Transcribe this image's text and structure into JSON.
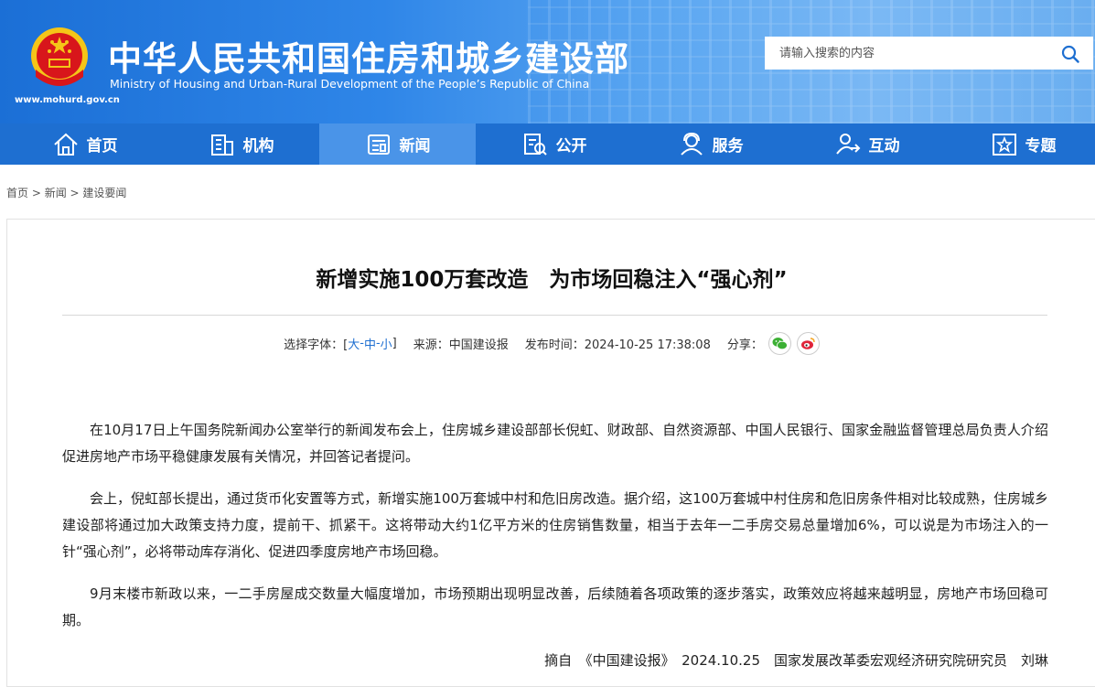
{
  "header": {
    "title_cn": "中华人民共和国住房和城乡建设部",
    "title_en": "Ministry of Housing and Urban-Rural Development of the People’s Republic of China",
    "site_url": "www.mohurd.gov.cn",
    "search_placeholder": "请输入搜索的内容"
  },
  "nav": {
    "items": [
      {
        "label": "首页",
        "icon": "home-icon"
      },
      {
        "label": "机构",
        "icon": "building-icon"
      },
      {
        "label": "新闻",
        "icon": "news-icon"
      },
      {
        "label": "公开",
        "icon": "disclosure-icon"
      },
      {
        "label": "服务",
        "icon": "service-icon"
      },
      {
        "label": "互动",
        "icon": "interaction-icon"
      },
      {
        "label": "专题",
        "icon": "star-icon"
      }
    ],
    "active_index": 2
  },
  "breadcrumb": {
    "home": "首页",
    "sep1": " > ",
    "news": "新闻",
    "sep2": " > ",
    "current": "建设要闻"
  },
  "article": {
    "title": "新增实施100万套改造　为市场回稳注入“强心剂”",
    "meta": {
      "font_label": "选择字体：[ ",
      "size_large": "大",
      "size_mid": "中",
      "size_small": "小",
      "dash": " - ",
      "font_close": " ]",
      "source_label": "来源：中国建设报",
      "time_label": "发布时间：2024-10-25 17:38:08",
      "share_label": "分享："
    },
    "paragraphs": [
      "在10月17日上午国务院新闻办公室举行的新闻发布会上，住房城乡建设部部长倪虹、财政部、自然资源部、中国人民银行、国家金融监督管理总局负责人介绍促进房地产市场平稳健康发展有关情况，并回答记者提问。",
      "会上，倪虹部长提出，通过货币化安置等方式，新增实施100万套城中村和危旧房改造。据介绍，这100万套城中村住房和危旧房条件相对比较成熟，住房城乡建设部将通过加大政策支持力度，提前干、抓紧干。这将带动大约1亿平方米的住房销售数量，相当于去年一二手房交易总量增加6%，可以说是为市场注入的一针“强心剂”，必将带动库存消化、促进四季度房地产市场回稳。",
      "9月末楼市新政以来，一二手房屋成交数量大幅度增加，市场预期出现明显改善，后续随着各项政策的逐步落实，政策效应将越来越明显，房地产市场回稳可期。"
    ],
    "source_line": "摘自　《中国建设报》　2024.10.25　国家发展改革委宏观经济研究院研究员　刘琳"
  },
  "colors": {
    "nav_bg": "#1e6fd1",
    "nav_active": "#4a94e8",
    "wechat": "#3cb034",
    "weibo": "#e0243a"
  }
}
